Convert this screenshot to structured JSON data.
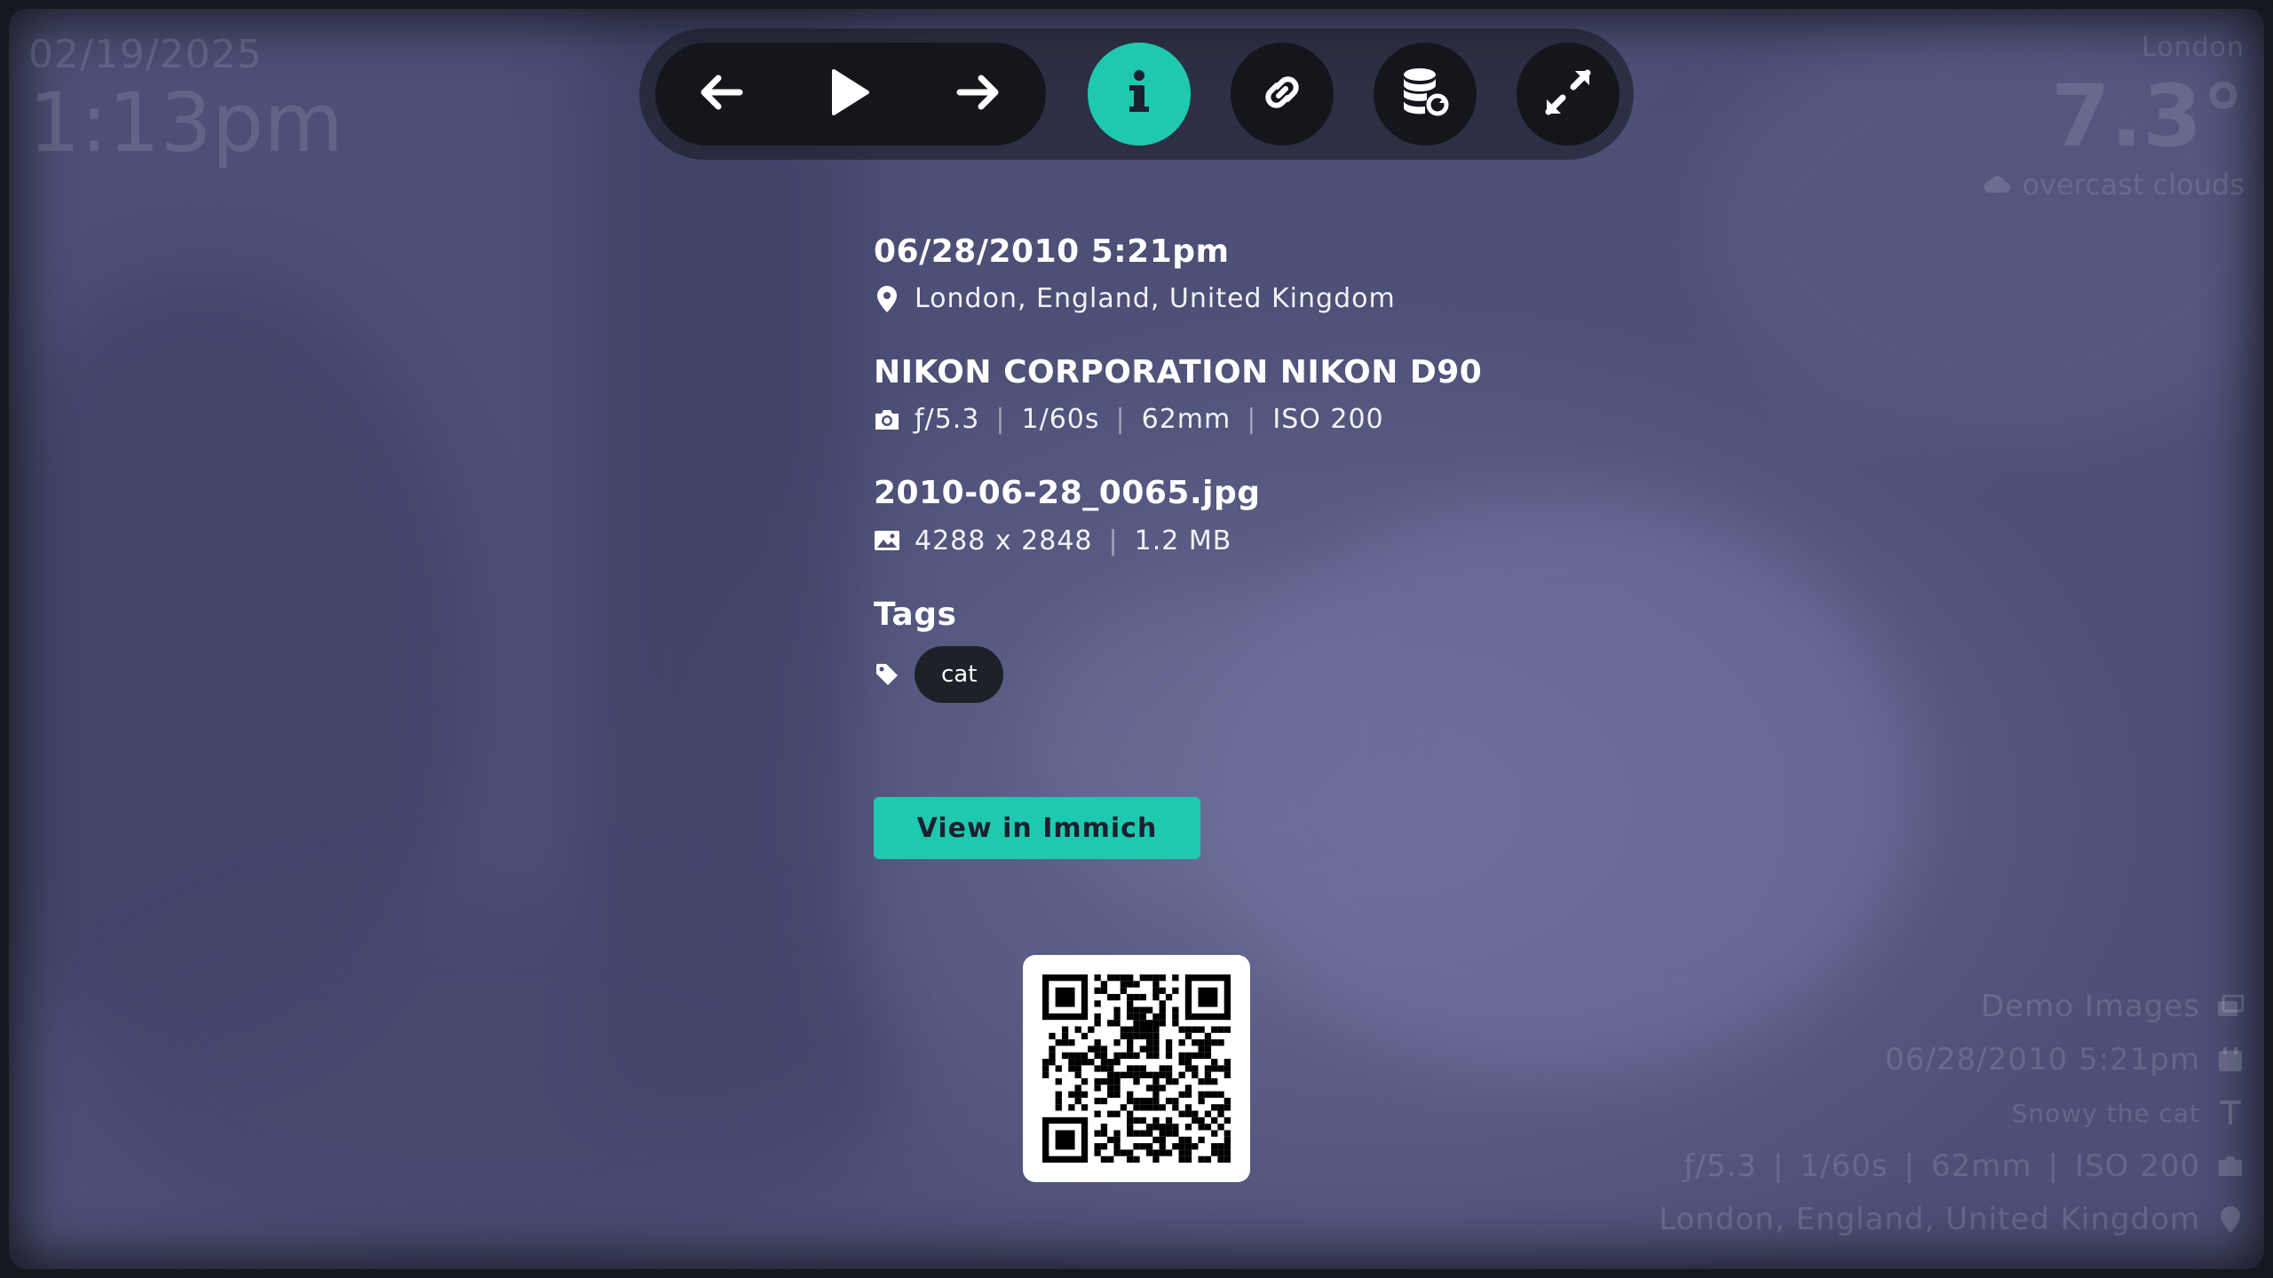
{
  "clock": {
    "date": "02/19/2025",
    "time": "1:13pm"
  },
  "weather": {
    "location": "London",
    "temperature": "7.3°",
    "description": "overcast clouds",
    "icon": "cloud-icon"
  },
  "toolbar": {
    "buttons": [
      {
        "name": "previous",
        "icon": "arrow-left-icon"
      },
      {
        "name": "play",
        "icon": "play-icon"
      },
      {
        "name": "next",
        "icon": "arrow-right-icon"
      },
      {
        "name": "info",
        "icon": "info-icon",
        "active": true
      },
      {
        "name": "link",
        "icon": "link-icon"
      },
      {
        "name": "cache",
        "icon": "database-refresh-icon"
      },
      {
        "name": "fullscreen",
        "icon": "expand-icon"
      }
    ]
  },
  "info": {
    "datetime": "06/28/2010 5:21pm",
    "location": "London, England, United Kingdom",
    "camera": "NIKON CORPORATION NIKON D90",
    "exposure": {
      "aperture": "ƒ/5.3",
      "shutter": "1/60s",
      "focal_length": "62mm",
      "iso": "ISO 200"
    },
    "filename": "2010-06-28_0065.jpg",
    "dimensions": "4288 x 2848",
    "filesize": "1.2 MB",
    "tags_heading": "Tags",
    "tags": [
      "cat"
    ],
    "view_button": "View in Immich"
  },
  "metadata": {
    "album": "Demo Images",
    "date": "06/28/2010 5:21pm",
    "description": "Snowy the cat",
    "exposure": {
      "aperture": "ƒ/5.3",
      "shutter": "1/60s",
      "focal_length": "62mm",
      "iso": "ISO 200"
    },
    "location": "London, England, United Kingdom"
  },
  "colors": {
    "accent": "#1ec9b0",
    "button_bg": "#14161c",
    "tag_bg": "#1f2129",
    "photo_tint": "#4b4e75"
  }
}
